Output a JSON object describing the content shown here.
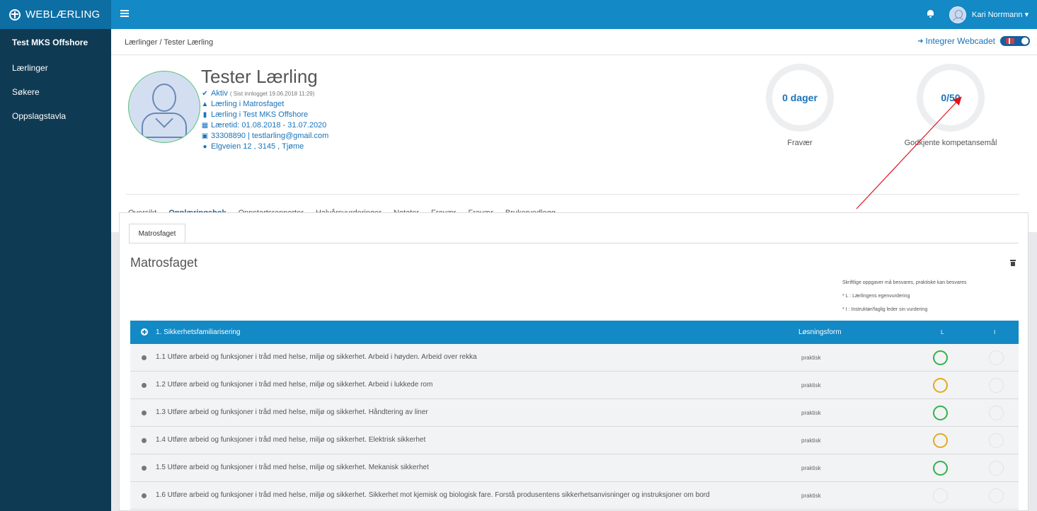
{
  "app": {
    "brand": "WEBLÆRLING"
  },
  "header": {
    "user_name": "Kari Norrmann ▾"
  },
  "sidebar": {
    "org": "Test MKS Offshore",
    "items": [
      {
        "label": "Lærlinger"
      },
      {
        "label": "Søkere"
      },
      {
        "label": "Oppslagstavla"
      }
    ]
  },
  "breadcrumb": {
    "path": "Lærlinger / Tester Lærling"
  },
  "webcadet": {
    "label": "Integrer Webcadet"
  },
  "profile": {
    "name": "Tester Lærling",
    "status": "Aktiv",
    "last_login": "( Sist innlogget  19.06.2018 11:29)",
    "trade": "Lærling i Matrosfaget",
    "company": "Lærling i Test MKS Offshore",
    "period": "Læretid: 01.08.2018 - 31.07.2020",
    "contact": "33308890 | testlarling@gmail.com",
    "address": "Elgveien 12 , 3145 , Tjøme"
  },
  "stats": {
    "absence": {
      "value": "0 dager",
      "label": "Fravær"
    },
    "approved": {
      "value": "0/50",
      "label": "Godkjente kompetansemål"
    }
  },
  "tabs": [
    {
      "label": "Oversikt"
    },
    {
      "label": "Opplæringsbok"
    },
    {
      "label": "Oppstartsrapporter"
    },
    {
      "label": "Halvårsvurderinger"
    },
    {
      "label": "Notater"
    },
    {
      "label": "Fravær"
    },
    {
      "label": "Fravær"
    },
    {
      "label": "Brukervedlegg"
    }
  ],
  "book": {
    "tab": "Matrosfaget",
    "title": "Matrosfaget",
    "legend": {
      "line1": "Skriftlige oppgaver må besvares, praktiske kan besvares",
      "line2": "* L :   Lærlingens egenvurdering",
      "line3": "* I :   Instruktør/faglig leder sin vurdering"
    },
    "table": {
      "section": "1. Sikkerhetsfamiliarisering",
      "col_form": "Løsningsform",
      "col_l": "L",
      "col_i": "I",
      "rows": [
        {
          "text": "1.1 Utføre arbeid og funksjoner i tråd med helse, miljø og sikkerhet. Arbeid i høyden. Arbeid over rekka",
          "form": "praktisk",
          "l_color": "#2fb34a"
        },
        {
          "text": "1.2 Utføre arbeid og funksjoner i tråd med helse, miljø og sikkerhet. Arbeid i lukkede rom",
          "form": "praktisk",
          "l_color": "#e5a91c"
        },
        {
          "text": "1.3 Utføre arbeid og funksjoner i tråd med helse, miljø og sikkerhet. Håndtering av liner",
          "form": "praktisk",
          "l_color": "#2fb34a"
        },
        {
          "text": "1.4 Utføre arbeid og funksjoner i tråd med helse, miljø og sikkerhet. Elektrisk sikkerhet",
          "form": "praktisk",
          "l_color": "#e5a91c"
        },
        {
          "text": "1.5 Utføre arbeid og funksjoner i tråd med helse, miljø og sikkerhet. Mekanisk sikkerhet",
          "form": "praktisk",
          "l_color": "#2fb34a"
        },
        {
          "text": "1.6 Utføre arbeid og funksjoner i tråd med helse, miljø og sikkerhet. Sikkerhet mot kjemisk og biologisk fare. Forstå produsentens sikkerhetsanvisninger og instruksjoner om bord",
          "form": "praktisk",
          "l_color": "#e3e3e3"
        }
      ]
    }
  },
  "colors": {
    "header": "#1389c5",
    "sidebar": "#0f3a53",
    "accent": "#1a73b8",
    "annotation": "#e0131b"
  }
}
